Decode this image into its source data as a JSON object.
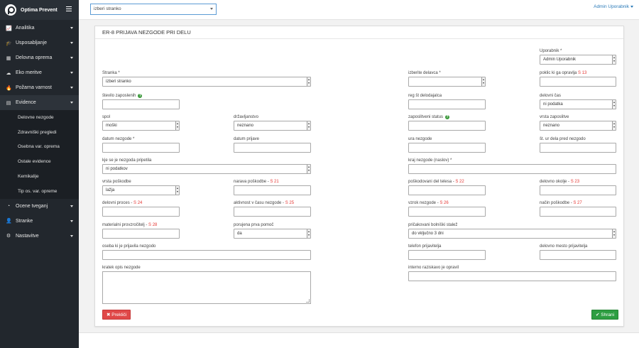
{
  "app": {
    "brand": "Optima Prevent"
  },
  "sidebar": {
    "items": [
      {
        "icon": "📈",
        "label": "Analitika"
      },
      {
        "icon": "🎓",
        "label": "Usposabljanje"
      },
      {
        "icon": "▦",
        "label": "Delovna oprema"
      },
      {
        "icon": "☁",
        "label": "Eko meritve"
      },
      {
        "icon": "🔥",
        "label": "Požarna varnost"
      },
      {
        "icon": "▤",
        "label": "Evidence"
      }
    ],
    "sub_items": [
      "Delovne nezgode",
      "Zdravniški pregledi",
      "Osebna var. oprema",
      "Ostale evidence",
      "Kemikalije",
      "Tip os. var. opreme"
    ],
    "bottom_items": [
      {
        "icon": "◔",
        "label": "Ocene tveganj"
      },
      {
        "icon": "👤",
        "label": "Stranke"
      },
      {
        "icon": "⚙",
        "label": "Nastavitve"
      }
    ]
  },
  "topbar": {
    "client_select": "izberi stranko",
    "user": "Admin Uporabnik"
  },
  "form": {
    "title": "ER-8 PRIJAVA NEZGODE PRI DELU",
    "uporabnik": {
      "label": "Uporabnik *",
      "value": "Admin Uporabnik"
    },
    "stranka": {
      "label": "Stranka *",
      "value": "izberi stranko"
    },
    "izberite_delavca": {
      "label": "izberite delavca *",
      "value": ""
    },
    "poklic": {
      "label": "poklic ki ga opravlja",
      "code": "S 13"
    },
    "stevilo_zaposlenih": {
      "label": "število zaposlenih"
    },
    "reg_st": {
      "label": "reg št delodajalca"
    },
    "delovni_cas": {
      "label": "delovni čas",
      "value": "ni podatka"
    },
    "spol": {
      "label": "spol",
      "value": "moški"
    },
    "drzavljanstvo": {
      "label": "državljanstvo",
      "value": "neznano"
    },
    "zaposlitveni_status": {
      "label": "zaposlitveni status"
    },
    "vrsta_zaposlitve": {
      "label": "vrsta zaposlitve",
      "value": "neznano"
    },
    "datum_nezgode": {
      "label": "datum nezgode *"
    },
    "datum_prijave": {
      "label": "datum prijave"
    },
    "ura_nezgode": {
      "label": "ura nezgode"
    },
    "st_ur": {
      "label": "št. ur dela pred nezgodo"
    },
    "kje": {
      "label": "kje se je nezgoda pripetila",
      "value": "ni podatkov"
    },
    "kraj": {
      "label": "kraj nezgode (naslov) *"
    },
    "vrsta_poskodbe": {
      "label": "vrsta poškodbe",
      "value": "lažja"
    },
    "narava": {
      "label": "narava poškodbe - ",
      "code": "S 21"
    },
    "poskodovani_del": {
      "label": "poškodovani del telesa - ",
      "code": "S 22"
    },
    "delovno_okolje": {
      "label": "delovno okolje - ",
      "code": "S 23"
    },
    "delovni_proces": {
      "label": "delovni proces - ",
      "code": "S 24"
    },
    "aktivnost": {
      "label": "aktivnost v času nezgode - ",
      "code": "S 25"
    },
    "vzrok": {
      "label": "vzrok nezgode - ",
      "code": "S 26"
    },
    "nacin": {
      "label": "način poškodbe - ",
      "code": "S 27"
    },
    "materialni": {
      "label": "materialni provzročitelj - ",
      "code": "S 28"
    },
    "prva_pomoc": {
      "label": "porujena prva pomoč",
      "value": "da"
    },
    "bolniski": {
      "label": "pričakovani bolniški stalež",
      "value": "do vključno 3 dni"
    },
    "oseba": {
      "label": "oseba ki je prijavila nezgodo"
    },
    "telefon": {
      "label": "telefon prijavitelja"
    },
    "delovno_mesto": {
      "label": "delovno mesto prijavitelja"
    },
    "opis": {
      "label": "kratek opis nezgode"
    },
    "interno": {
      "label": "interno raziskavo je opravil"
    },
    "cancel_button": "Prekliči",
    "save_button": "Shrani"
  },
  "colors": {
    "sidebar_bg": "#22272d",
    "accent_link": "#2a7ab8",
    "cancel": "#e04848",
    "save": "#2e9e42",
    "code": "#e53935"
  }
}
